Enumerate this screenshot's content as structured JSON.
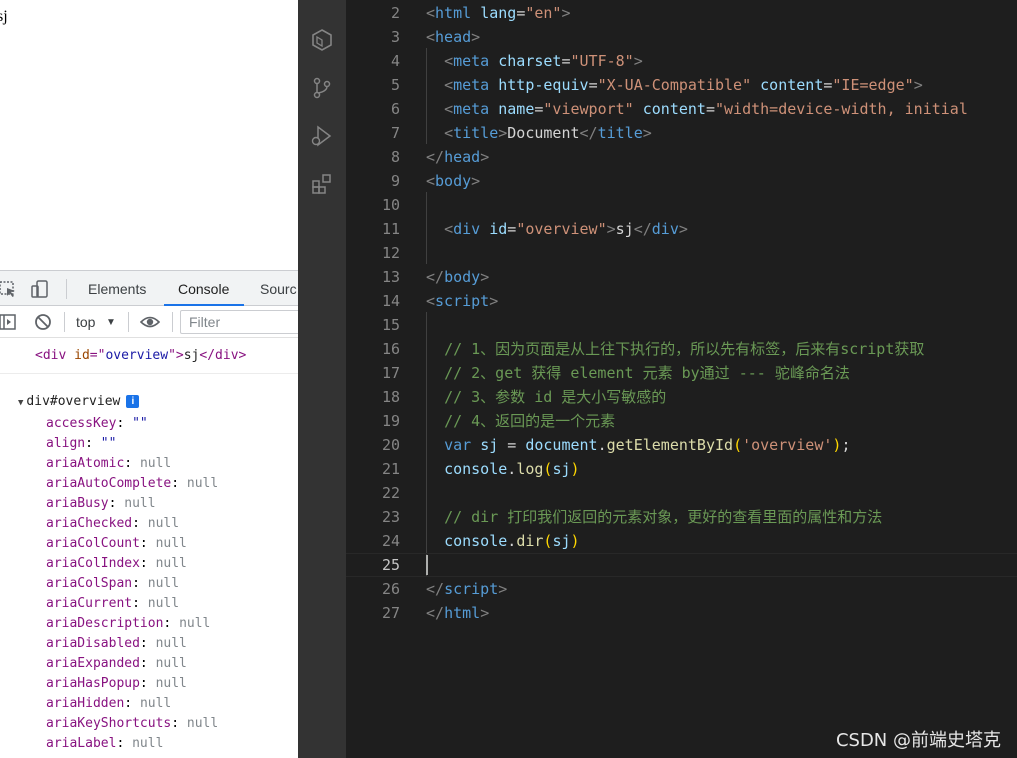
{
  "browser_page": {
    "text": "sj"
  },
  "devtools": {
    "tabs": [
      {
        "label": "Elements",
        "active": false
      },
      {
        "label": "Console",
        "active": true
      },
      {
        "label": "Sourc",
        "active": false
      }
    ],
    "toolbar": {
      "context": "top",
      "filter_placeholder": "Filter"
    },
    "log": {
      "tag_open": "<div",
      "attr": "id",
      "eq": "=\"",
      "value": "overview",
      "close_q": "\">",
      "text": "sj",
      "tag_close": "</div>"
    },
    "dir": {
      "header": "div#overview",
      "info_badge": "i",
      "props": [
        {
          "key": "accessKey",
          "value": "\"\""
        },
        {
          "key": "align",
          "value": "\"\""
        },
        {
          "key": "ariaAtomic",
          "value": "null"
        },
        {
          "key": "ariaAutoComplete",
          "value": "null"
        },
        {
          "key": "ariaBusy",
          "value": "null"
        },
        {
          "key": "ariaChecked",
          "value": "null"
        },
        {
          "key": "ariaColCount",
          "value": "null"
        },
        {
          "key": "ariaColIndex",
          "value": "null"
        },
        {
          "key": "ariaColSpan",
          "value": "null"
        },
        {
          "key": "ariaCurrent",
          "value": "null"
        },
        {
          "key": "ariaDescription",
          "value": "null"
        },
        {
          "key": "ariaDisabled",
          "value": "null"
        },
        {
          "key": "ariaExpanded",
          "value": "null"
        },
        {
          "key": "ariaHasPopup",
          "value": "null"
        },
        {
          "key": "ariaHidden",
          "value": "null"
        },
        {
          "key": "ariaKeyShortcuts",
          "value": "null"
        },
        {
          "key": "ariaLabel",
          "value": "null"
        }
      ]
    }
  },
  "editor": {
    "active_line": 25,
    "lines": [
      {
        "n": "2",
        "tokens": [
          [
            "k-punc",
            "<"
          ],
          [
            "k-tag",
            "html"
          ],
          [
            "k-text",
            " "
          ],
          [
            "k-attr",
            "lang"
          ],
          [
            "k-text",
            "="
          ],
          [
            "k-str",
            "\"en\""
          ],
          [
            "k-punc",
            ">"
          ]
        ]
      },
      {
        "n": "3",
        "tokens": [
          [
            "k-punc",
            "<"
          ],
          [
            "k-tag",
            "head"
          ],
          [
            "k-punc",
            ">"
          ]
        ]
      },
      {
        "n": "4",
        "tokens": [
          [
            "k-text",
            "  "
          ],
          [
            "k-punc",
            "<"
          ],
          [
            "k-tag",
            "meta"
          ],
          [
            "k-text",
            " "
          ],
          [
            "k-attr",
            "charset"
          ],
          [
            "k-text",
            "="
          ],
          [
            "k-str",
            "\"UTF-8\""
          ],
          [
            "k-punc",
            ">"
          ]
        ]
      },
      {
        "n": "5",
        "tokens": [
          [
            "k-text",
            "  "
          ],
          [
            "k-punc",
            "<"
          ],
          [
            "k-tag",
            "meta"
          ],
          [
            "k-text",
            " "
          ],
          [
            "k-attr",
            "http-equiv"
          ],
          [
            "k-text",
            "="
          ],
          [
            "k-str",
            "\"X-UA-Compatible\""
          ],
          [
            "k-text",
            " "
          ],
          [
            "k-attr",
            "content"
          ],
          [
            "k-text",
            "="
          ],
          [
            "k-str",
            "\"IE=edge\""
          ],
          [
            "k-punc",
            ">"
          ]
        ]
      },
      {
        "n": "6",
        "tokens": [
          [
            "k-text",
            "  "
          ],
          [
            "k-punc",
            "<"
          ],
          [
            "k-tag",
            "meta"
          ],
          [
            "k-text",
            " "
          ],
          [
            "k-attr",
            "name"
          ],
          [
            "k-text",
            "="
          ],
          [
            "k-str",
            "\"viewport\""
          ],
          [
            "k-text",
            " "
          ],
          [
            "k-attr",
            "content"
          ],
          [
            "k-text",
            "="
          ],
          [
            "k-str",
            "\"width=device-width, initial"
          ]
        ]
      },
      {
        "n": "7",
        "tokens": [
          [
            "k-text",
            "  "
          ],
          [
            "k-punc",
            "<"
          ],
          [
            "k-tag",
            "title"
          ],
          [
            "k-punc",
            ">"
          ],
          [
            "k-text",
            "Document"
          ],
          [
            "k-punc",
            "</"
          ],
          [
            "k-tag",
            "title"
          ],
          [
            "k-punc",
            ">"
          ]
        ]
      },
      {
        "n": "8",
        "tokens": [
          [
            "k-punc",
            "</"
          ],
          [
            "k-tag",
            "head"
          ],
          [
            "k-punc",
            ">"
          ]
        ]
      },
      {
        "n": "9",
        "tokens": [
          [
            "k-punc",
            "<"
          ],
          [
            "k-tag",
            "body"
          ],
          [
            "k-punc",
            ">"
          ]
        ]
      },
      {
        "n": "10",
        "tokens": []
      },
      {
        "n": "11",
        "tokens": [
          [
            "k-text",
            "  "
          ],
          [
            "k-punc",
            "<"
          ],
          [
            "k-tag",
            "div"
          ],
          [
            "k-text",
            " "
          ],
          [
            "k-attr",
            "id"
          ],
          [
            "k-text",
            "="
          ],
          [
            "k-str",
            "\"overview\""
          ],
          [
            "k-punc",
            ">"
          ],
          [
            "k-text",
            "sj"
          ],
          [
            "k-punc",
            "</"
          ],
          [
            "k-tag",
            "div"
          ],
          [
            "k-punc",
            ">"
          ]
        ]
      },
      {
        "n": "12",
        "tokens": []
      },
      {
        "n": "13",
        "tokens": [
          [
            "k-punc",
            "</"
          ],
          [
            "k-tag",
            "body"
          ],
          [
            "k-punc",
            ">"
          ]
        ]
      },
      {
        "n": "14",
        "tokens": [
          [
            "k-punc",
            "<"
          ],
          [
            "k-tag",
            "script"
          ],
          [
            "k-punc",
            ">"
          ]
        ]
      },
      {
        "n": "15",
        "tokens": []
      },
      {
        "n": "16",
        "tokens": [
          [
            "k-text",
            "  "
          ],
          [
            "k-com",
            "// 1、因为页面是从上往下执行的，所以先有标签，后来有script获取"
          ]
        ]
      },
      {
        "n": "17",
        "tokens": [
          [
            "k-text",
            "  "
          ],
          [
            "k-com",
            "// 2、get 获得 element 元素 by通过 --- 驼峰命名法"
          ]
        ]
      },
      {
        "n": "18",
        "tokens": [
          [
            "k-text",
            "  "
          ],
          [
            "k-com",
            "// 3、参数 id 是大小写敏感的"
          ]
        ]
      },
      {
        "n": "19",
        "tokens": [
          [
            "k-text",
            "  "
          ],
          [
            "k-com",
            "// 4、返回的是一个元素"
          ]
        ]
      },
      {
        "n": "20",
        "tokens": [
          [
            "k-text",
            "  "
          ],
          [
            "k-kw",
            "var"
          ],
          [
            "k-text",
            " "
          ],
          [
            "k-var",
            "sj"
          ],
          [
            "k-text",
            " = "
          ],
          [
            "k-var",
            "document"
          ],
          [
            "k-text",
            "."
          ],
          [
            "k-fn",
            "getElementById"
          ],
          [
            "k-brk",
            "("
          ],
          [
            "k-str",
            "'overview'"
          ],
          [
            "k-brk",
            ")"
          ],
          [
            "k-text",
            ";"
          ]
        ]
      },
      {
        "n": "21",
        "tokens": [
          [
            "k-text",
            "  "
          ],
          [
            "k-var",
            "console"
          ],
          [
            "k-text",
            "."
          ],
          [
            "k-fn",
            "log"
          ],
          [
            "k-brk",
            "("
          ],
          [
            "k-var",
            "sj"
          ],
          [
            "k-brk",
            ")"
          ]
        ]
      },
      {
        "n": "22",
        "tokens": []
      },
      {
        "n": "23",
        "tokens": [
          [
            "k-text",
            "  "
          ],
          [
            "k-com",
            "// dir 打印我们返回的元素对象，更好的查看里面的属性和方法"
          ]
        ]
      },
      {
        "n": "24",
        "tokens": [
          [
            "k-text",
            "  "
          ],
          [
            "k-var",
            "console"
          ],
          [
            "k-text",
            "."
          ],
          [
            "k-fn",
            "dir"
          ],
          [
            "k-brk",
            "("
          ],
          [
            "k-var",
            "sj"
          ],
          [
            "k-brk",
            ")"
          ]
        ]
      },
      {
        "n": "25",
        "tokens": []
      },
      {
        "n": "26",
        "tokens": [
          [
            "k-punc",
            "</"
          ],
          [
            "k-tag",
            "script"
          ],
          [
            "k-punc",
            ">"
          ]
        ]
      },
      {
        "n": "27",
        "tokens": [
          [
            "k-punc",
            "</"
          ],
          [
            "k-tag",
            "html"
          ],
          [
            "k-punc",
            ">"
          ]
        ]
      }
    ]
  },
  "watermark": "CSDN @前端史塔克",
  "icons": {
    "devtools": [
      "inspect-icon",
      "device-toggle-icon",
      "sidebar-toggle-icon",
      "clear-console-icon",
      "eye-icon"
    ],
    "activity_bar": [
      "files-icon",
      "box-icon",
      "source-control-icon",
      "run-debug-icon",
      "extensions-icon"
    ]
  },
  "colors": {
    "accent": "#1a73e8",
    "editor_bg": "#1e1e1e",
    "activity_bg": "#333333"
  }
}
